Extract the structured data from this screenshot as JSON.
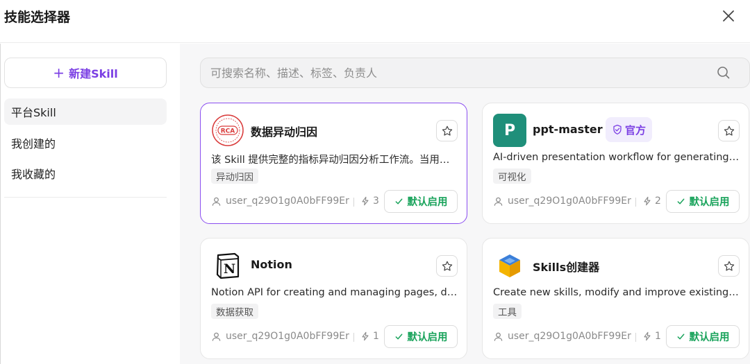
{
  "header": {
    "title": "技能选择器"
  },
  "sidebar": {
    "new_skill_label": "新建Skill",
    "items": [
      {
        "label": "平台Skill",
        "active": true
      },
      {
        "label": "我创建的",
        "active": false
      },
      {
        "label": "我收藏的",
        "active": false
      }
    ]
  },
  "search": {
    "placeholder": "可搜索名称、描述、标签、负责人"
  },
  "cards": [
    {
      "logo_text": "RCA",
      "name": "数据异动归因",
      "official": "",
      "desc": "该 Skill 提供完整的指标异动归因分析工作流。当用户需要分析指标异动原因时使用",
      "tag": "异动归因",
      "owner": "user_q29O1g0A0bFF99Er",
      "usage": "3",
      "enable_label": "默认启用",
      "selected": true
    },
    {
      "logo_text": "P",
      "name": "ppt-master",
      "official": "官方",
      "desc": "AI-driven presentation workflow for generating slides",
      "tag": "可视化",
      "owner": "user_q29O1g0A0bFF99Er",
      "usage": "2",
      "enable_label": "默认启用",
      "selected": false
    },
    {
      "logo_text": "N",
      "name": "Notion",
      "official": "",
      "desc": "Notion API for creating and managing pages, databases and blocks",
      "tag": "数据获取",
      "owner": "user_q29O1g0A0bFF99Er",
      "usage": "1",
      "enable_label": "默认启用",
      "selected": false
    },
    {
      "logo_text": "",
      "name": "Skills创建器",
      "official": "",
      "desc": "Create new skills, modify and improve existing skills",
      "tag": "工具",
      "owner": "user_q29O1g0A0bFF99Er",
      "usage": "1",
      "enable_label": "默认启用",
      "selected": false
    }
  ],
  "colors": {
    "accent": "#7b3fe4",
    "enable_green": "#19a35b",
    "ppt_logo": "#1f8f7a"
  }
}
